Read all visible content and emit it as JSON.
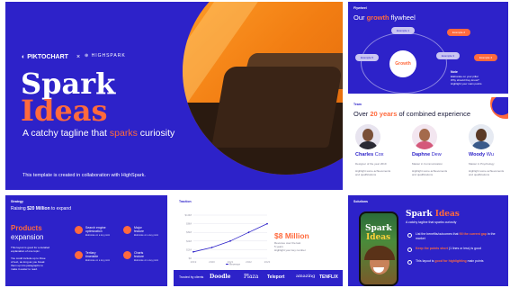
{
  "slide1": {
    "brand1": "PIKTOCHART",
    "x": "×",
    "brand2": "HIGHSPARK",
    "title1": "Spark",
    "title2": "Ideas",
    "tagline_pre": "A catchy tagline that ",
    "tagline_hl": "sparks",
    "tagline_post": " curiosity",
    "footer": "This template is created in collaboration with HighSpark."
  },
  "slide2": {
    "kicker": "Flywheel",
    "title_pre": "Our ",
    "title_hl": "growth",
    "title_post": " flywheel",
    "center": "Growth",
    "nodes": [
      "Example 1",
      "Example 2",
      "Example 3",
      "Example 4",
      "Example 5"
    ],
    "note_title": "Note",
    "note_lines": [
      "Elaborate on your pillar",
      "Why should they know?",
      "Highlight your main points"
    ]
  },
  "slide3": {
    "kicker": "Team",
    "title_pre": "Over ",
    "title_hl": "20 years",
    "title_post": " of combined experience",
    "members": [
      {
        "first": "Charles",
        "last": "Cox",
        "role": "Designer of the year 2019",
        "desc1": "Highlight some achievements",
        "desc2": "and qualifications"
      },
      {
        "first": "Daphne",
        "last": "Dew",
        "role": "Master in Communication",
        "desc1": "Highlight some achievements",
        "desc2": "and qualifications"
      },
      {
        "first": "Woody",
        "last": "Wu",
        "role": "Master in Psychology",
        "desc1": "Highlight some achievements",
        "desc2": "and qualifications"
      }
    ]
  },
  "slide4": {
    "kicker": "Strategy",
    "sub_pre": "Raising ",
    "sub_hl": "$20 Million",
    "sub_post": " to expand",
    "heading1": "Products",
    "heading2": "expansion",
    "body": [
      "This layout is good for a detailed",
      "explanation of one topic.",
      "",
      "You could include up to three",
      "of text, as long as you break",
      "them up into paragraphs to",
      "make it easier to read."
    ],
    "items": [
      {
        "t1": "Search engine",
        "t2": "optimization",
        "d": "Elaborate on a key point"
      },
      {
        "t1": "Major",
        "t2": "feature",
        "d": "Elaborate on a key point"
      },
      {
        "t1": "Tertiary",
        "t2": "timetable",
        "d": "Elaborate on a key point"
      },
      {
        "t1": "Charts",
        "t2": "feature",
        "d": "Elaborate on a key point"
      }
    ]
  },
  "slide5": {
    "kicker": "Traction",
    "big": "$8 Million",
    "desc1": "Revenue over the last",
    "desc2": "5 years",
    "desc3": "Highlight your key number",
    "legend": "Revenue",
    "yticks": [
      "$10M",
      "$8M",
      "$6M",
      "$4M",
      "$2M",
      "$0"
    ],
    "xticks": [
      "2019",
      "2020",
      "2021",
      "2022",
      "2023"
    ],
    "trusted": "Trusted by clients",
    "logos": [
      "Doodle",
      "Plaza",
      "Teleport",
      "amazing",
      "TENFLIX"
    ]
  },
  "slide6": {
    "kicker": "Solutions",
    "phone_title1": "Spark",
    "phone_title2": "Ideas",
    "title1": "Spark",
    "title2": "Ideas",
    "tagline": "A catchy tagline that sparks curiosity",
    "points": [
      {
        "pre": "List the benefits/outcomes",
        "mid": "that ",
        "hl": "fill the current gap",
        "post": " in the market"
      },
      {
        "pre": "",
        "mid": "",
        "hl": "Keep the points short",
        "post": " (1 lines or less) is good"
      },
      {
        "pre": "This layout is ",
        "mid": "",
        "hl": "good for highlighting",
        "post": " main points"
      }
    ]
  },
  "chart_data": {
    "type": "line",
    "x": [
      "2019",
      "2020",
      "2021",
      "2022",
      "2023"
    ],
    "series": [
      {
        "name": "Revenue",
        "values": [
          1.5,
          2.5,
          4,
          6,
          8
        ]
      }
    ],
    "ylim": [
      0,
      10
    ],
    "title": "",
    "xlabel": "",
    "ylabel": ""
  },
  "colors": {
    "primary": "#2d22c9",
    "accent": "#ff6a3d",
    "light": "#c9c5f2"
  }
}
